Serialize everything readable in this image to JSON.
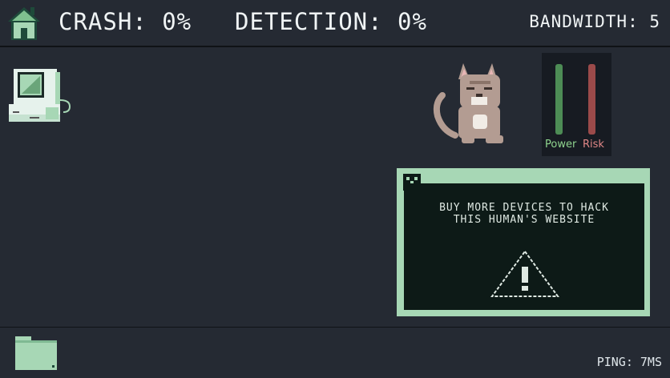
{
  "hud": {
    "crash": "CRASH: 0%",
    "detection": "DETECTION: 0%",
    "bandwidth": "BANDWIDTH: 5"
  },
  "meters": {
    "power_label": "Power",
    "risk_label": "Risk",
    "power_level": 1.0,
    "risk_level": 1.0,
    "power_color": "#4d8c55",
    "risk_color": "#9b4a4a"
  },
  "popup": {
    "message": "BUY MORE DEVICES TO HACK THIS HUMAN'S WEBSITE",
    "icon": "warning-triangle-icon",
    "close_icon": "close-icon"
  },
  "footer": {
    "ping": "PING: 7MS"
  },
  "icons": {
    "home": "home-icon",
    "computer": "computer-icon",
    "cat": "cat-mascot",
    "folder": "folder-icon"
  },
  "colors": {
    "background": "#252a33",
    "accent": "#a7d7b5",
    "popup_bg": "#0d1a17"
  }
}
